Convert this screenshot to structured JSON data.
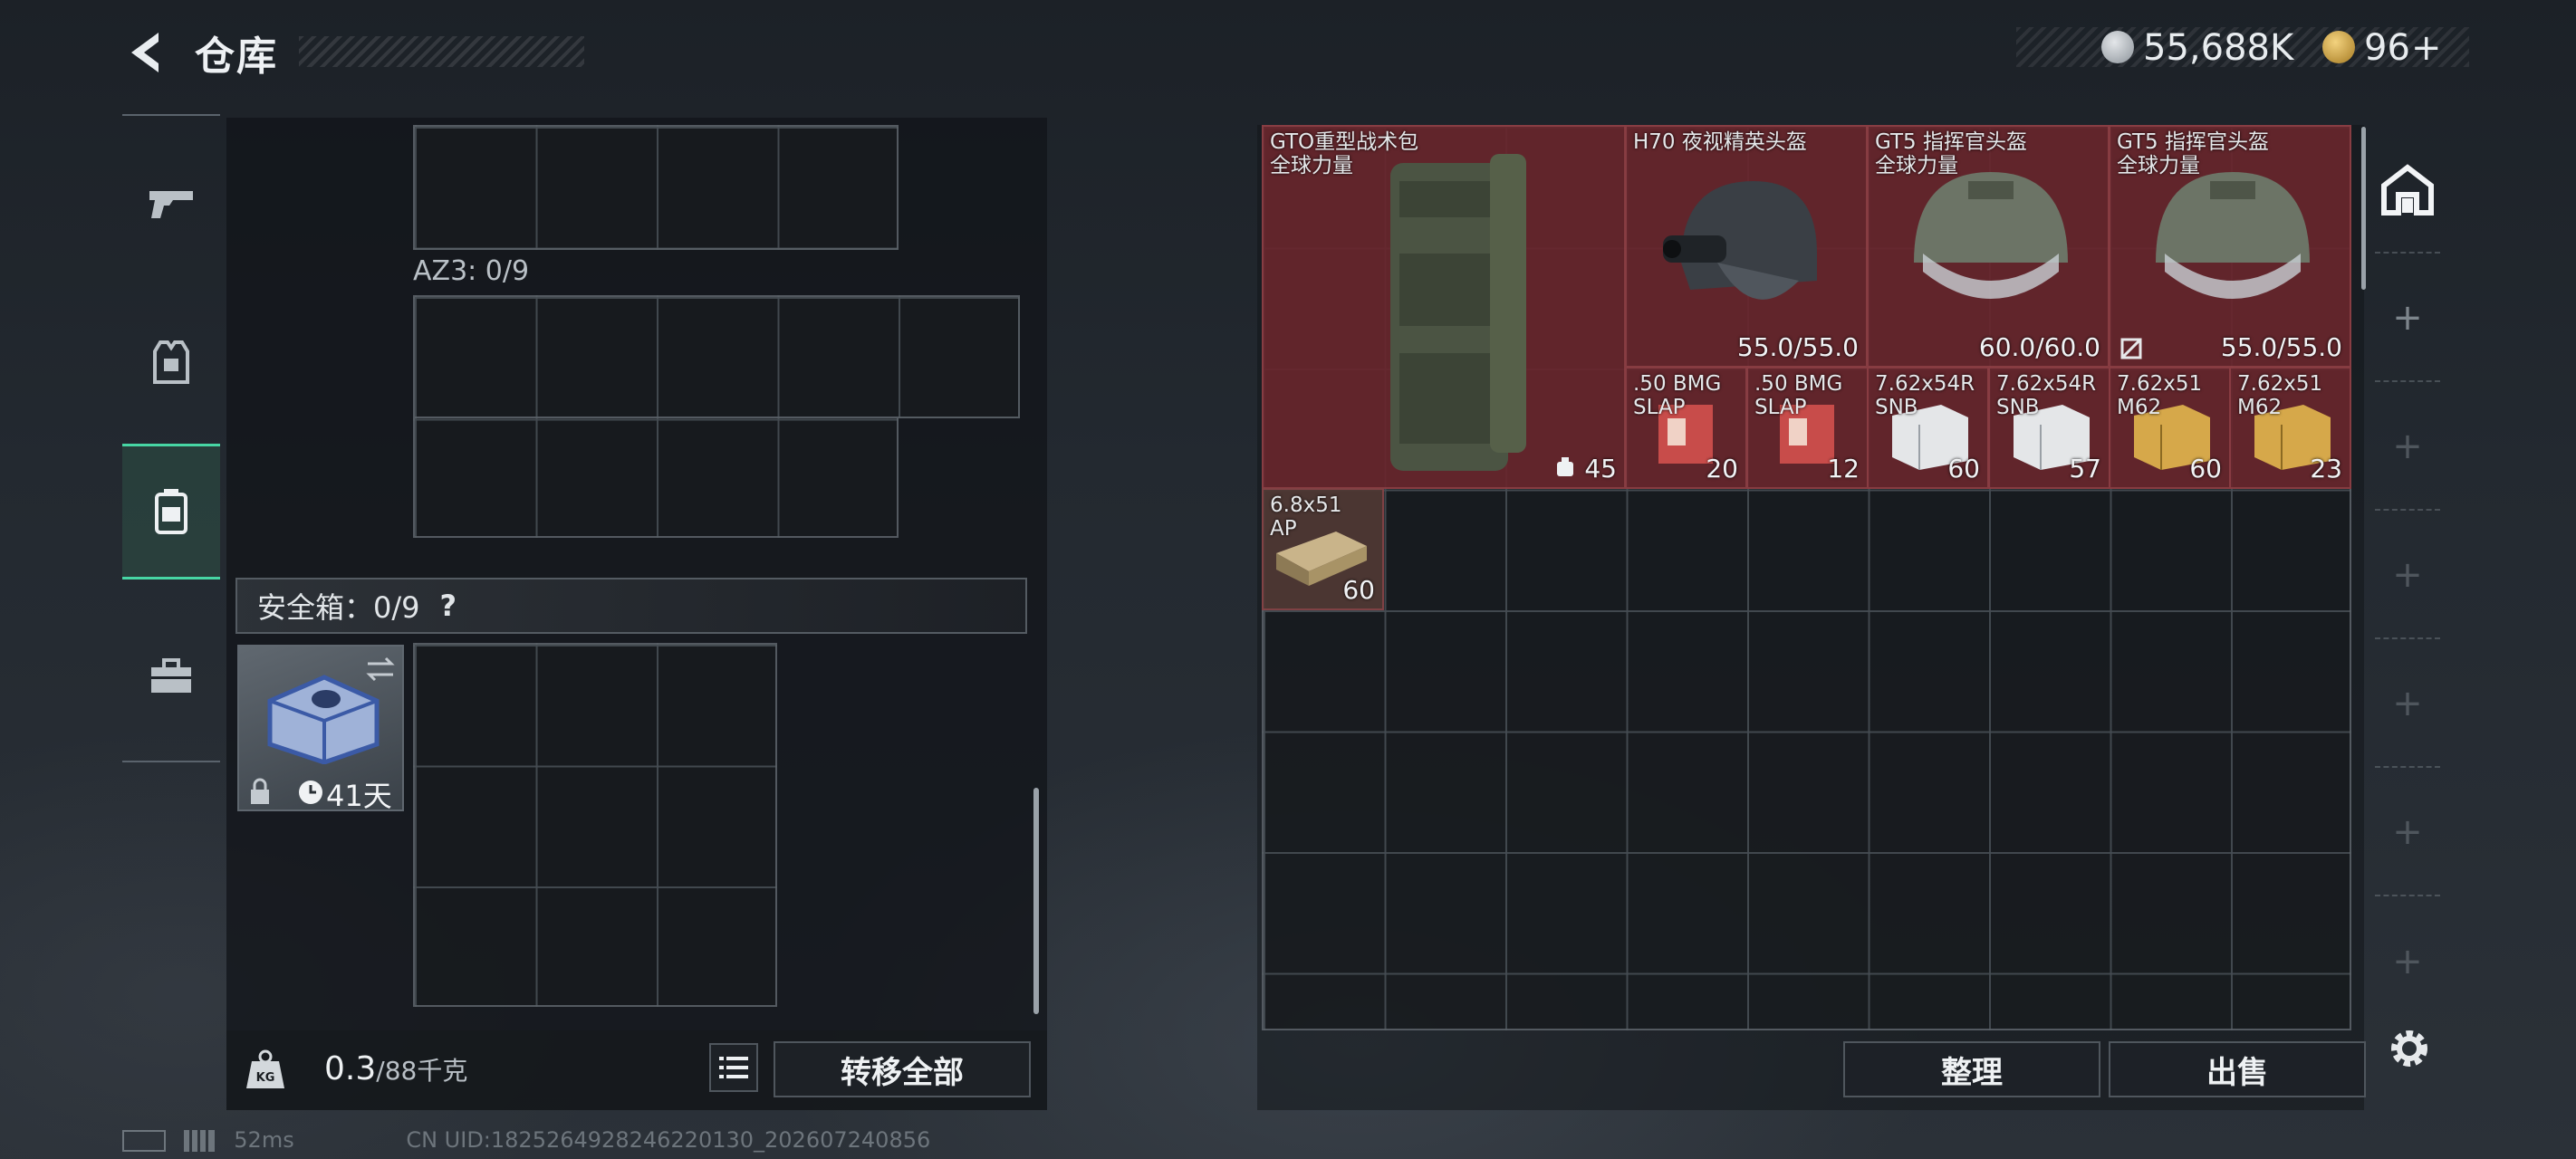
{
  "header": {
    "title": "仓库",
    "silver_amount": "55,688K",
    "gold_amount": "96",
    "gold_add": "+"
  },
  "left_panel": {
    "container_label": "AZ3: 0/9",
    "safe_label": "安全箱：0/9",
    "safe_help": "?",
    "safe_timer": "41天",
    "weight_value": "0.3",
    "weight_max": "/88千克",
    "weight_badge": "KG",
    "transfer_all_label": "转移全部"
  },
  "bag": {
    "items": [
      {
        "name": "GTO重型战术包\n全球力量",
        "value": "45",
        "kind": "backpack"
      },
      {
        "name": "H70 夜视精英头盔",
        "value": "55.0/55.0",
        "kind": "helmet-dark"
      },
      {
        "name": "GT5 指挥官头盔\n全球力量",
        "value": "60.0/60.0",
        "kind": "helmet"
      },
      {
        "name": "GT5 指挥官头盔\n全球力量",
        "value": "55.0/55.0",
        "kind": "helmet"
      },
      {
        "name": ".50 BMG\nSLAP",
        "value": "20",
        "kind": "ammo-red"
      },
      {
        "name": ".50 BMG\nSLAP",
        "value": "12",
        "kind": "ammo-red"
      },
      {
        "name": "7.62x54R\nSNB",
        "value": "60",
        "kind": "ammo-white"
      },
      {
        "name": "7.62x54R\nSNB",
        "value": "57",
        "kind": "ammo-white"
      },
      {
        "name": "7.62x51\nM62",
        "value": "60",
        "kind": "ammo-gold"
      },
      {
        "name": "7.62x51\nM62",
        "value": "23",
        "kind": "ammo-gold"
      },
      {
        "name": "6.8x51\nAP",
        "value": "60",
        "kind": "ammo-tan"
      }
    ],
    "sort_label": "整理",
    "sell_label": "出售"
  },
  "status": {
    "ping": "52ms",
    "uid": "CN UID:1825264928246220130_202607240856"
  },
  "colors": {
    "accent": "#47d6a4",
    "item_bg": "#68262c",
    "panel_bg": "#121519"
  }
}
